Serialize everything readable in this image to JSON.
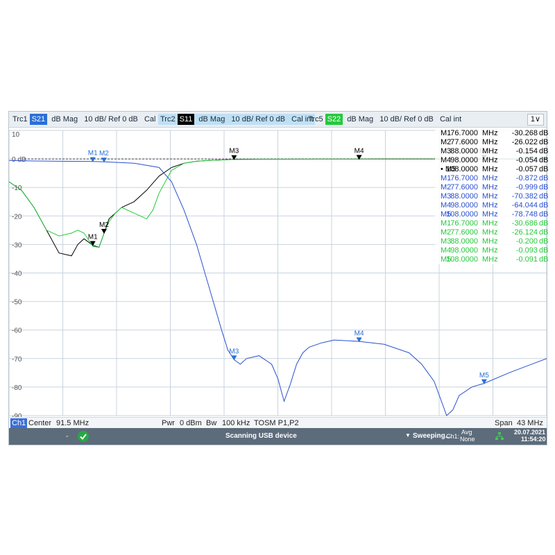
{
  "trace_tabs": [
    {
      "name": "Trc1",
      "param": "S21",
      "param_color": "#2a6fd6",
      "format": "dB Mag",
      "scale": "10 dB/ Ref 0 dB",
      "cal": "Cal int",
      "active": false
    },
    {
      "name": "Trc2",
      "param": "S11",
      "param_color": "#000000",
      "format": "dB Mag",
      "scale": "10 dB/ Ref 0 dB",
      "cal": "Cal int",
      "active": true
    },
    {
      "name": "Trc5",
      "param": "S22",
      "param_color": "#25c93b",
      "format": "dB Mag",
      "scale": "10 dB/ Ref 0 dB",
      "cal": "Cal int",
      "active": false
    }
  ],
  "menu_button": "1∨",
  "chart_data": {
    "type": "line",
    "y_ticks": [
      "10",
      "0 dB",
      "-10",
      "-20",
      "-30",
      "-40",
      "-50",
      "-60",
      "-70",
      "-80",
      "-90"
    ],
    "ylim": [
      -90,
      10
    ],
    "xlim_mhz": [
      70,
      113
    ],
    "ref_value_db": 0,
    "series": [
      {
        "color": "#000000",
        "x": [
          70,
          71,
          72,
          73,
          74,
          75,
          75.5,
          76,
          76.7,
          77.2,
          77.6,
          78,
          78.5,
          79,
          80,
          81,
          82,
          83,
          84,
          85,
          86,
          88,
          90,
          95,
          100,
          105,
          108,
          113
        ],
        "y": [
          -8,
          -11,
          -17,
          -25,
          -33,
          -34,
          -30,
          -28,
          -30.3,
          -31,
          -26,
          -21,
          -19,
          -17,
          -15,
          -11,
          -6,
          -3,
          -1.5,
          -0.8,
          -0.5,
          -0.15,
          -0.1,
          -0.08,
          -0.06,
          -0.06,
          -0.06,
          -0.05
        ]
      },
      {
        "color": "#25c93b",
        "x": [
          70,
          71,
          72,
          73,
          74,
          75,
          75.5,
          76,
          76.7,
          77.2,
          77.6,
          78,
          78.5,
          79,
          80,
          81,
          81.5,
          82,
          83,
          84,
          85,
          86,
          88,
          90,
          95,
          100,
          105,
          108,
          113
        ],
        "y": [
          -8,
          -11,
          -17,
          -25,
          -27,
          -26,
          -25,
          -26,
          -30.7,
          -31,
          -26,
          -22,
          -19,
          -17,
          -19,
          -21,
          -18,
          -12,
          -4,
          -1.5,
          -0.8,
          -0.5,
          -0.2,
          -0.12,
          -0.1,
          -0.09,
          -0.09,
          -0.09,
          -0.08
        ]
      },
      {
        "color": "#2a4fd0",
        "x": [
          70,
          72,
          74,
          76.7,
          77.6,
          80,
          82,
          83,
          84,
          85,
          86,
          87,
          87.5,
          88,
          88.5,
          89,
          90,
          91,
          91.5,
          92,
          92.5,
          93,
          93.5,
          94,
          95,
          96,
          98,
          100,
          102,
          103,
          104,
          104.5,
          105,
          105.5,
          106,
          107,
          108,
          110,
          113
        ],
        "y": [
          -0.5,
          -0.7,
          -0.8,
          -0.87,
          -1.0,
          -1.5,
          -3,
          -8,
          -18,
          -30,
          -45,
          -60,
          -67,
          -70.4,
          -72,
          -70,
          -69,
          -72,
          -77,
          -85,
          -79,
          -72,
          -68,
          -66,
          -64.5,
          -63.5,
          -64.0,
          -65,
          -68,
          -72,
          -78,
          -84,
          -90,
          -88,
          -83,
          -80,
          -78.7,
          -75,
          -70
        ]
      }
    ],
    "markers": [
      {
        "label": "M1",
        "color": "#2a6fd6",
        "x": 76.7,
        "y": -0.872
      },
      {
        "label": "M2",
        "color": "#2a6fd6",
        "x": 77.6,
        "y": -0.999
      },
      {
        "label": "M1",
        "color": "#000000",
        "x": 76.7,
        "y": -30.268
      },
      {
        "label": "M2",
        "color": "#000000",
        "x": 77.6,
        "y": -26.022
      },
      {
        "label": "M3",
        "color": "#000000",
        "x": 88,
        "y": -0.154
      },
      {
        "label": "M4",
        "color": "#000000",
        "x": 98,
        "y": -0.054
      },
      {
        "label": "M5",
        "color": "#000000",
        "x": 108,
        "y": -0.057
      },
      {
        "label": "M3",
        "color": "#2a6fd6",
        "x": 88,
        "y": -70.382
      },
      {
        "label": "M4",
        "color": "#2a6fd6",
        "x": 98,
        "y": -64.044
      },
      {
        "label": "M5",
        "color": "#2a6fd6",
        "x": 108,
        "y": -78.748
      }
    ]
  },
  "marker_table": [
    {
      "color": "#000000",
      "rows": [
        {
          "m": "M1",
          "f": "76.7000",
          "u": "MHz",
          "v": "-30.268",
          "d": "dB"
        },
        {
          "m": "M2",
          "f": "77.6000",
          "u": "MHz",
          "v": "-26.022",
          "d": "dB"
        },
        {
          "m": "M3",
          "f": "88.0000",
          "u": "MHz",
          "v": "-0.154",
          "d": "dB"
        },
        {
          "m": "M4",
          "f": "98.0000",
          "u": "MHz",
          "v": "-0.054",
          "d": "dB"
        },
        {
          "m": "• M5",
          "f": "108.0000",
          "u": "MHz",
          "v": "-0.057",
          "d": "dB"
        }
      ]
    },
    {
      "color": "#2a4fd0",
      "rows": [
        {
          "m": "M1",
          "f": "76.7000",
          "u": "MHz",
          "v": "-0.872",
          "d": "dB"
        },
        {
          "m": "M2",
          "f": "77.6000",
          "u": "MHz",
          "v": "-0.999",
          "d": "dB"
        },
        {
          "m": "M3",
          "f": "88.0000",
          "u": "MHz",
          "v": "-70.382",
          "d": "dB"
        },
        {
          "m": "M4",
          "f": "98.0000",
          "u": "MHz",
          "v": "-64.044",
          "d": "dB"
        },
        {
          "m": "M5",
          "f": "108.0000",
          "u": "MHz",
          "v": "-78.748",
          "d": "dB"
        }
      ]
    },
    {
      "color": "#25c93b",
      "rows": [
        {
          "m": "M1",
          "f": "76.7000",
          "u": "MHz",
          "v": "-30.686",
          "d": "dB"
        },
        {
          "m": "M2",
          "f": "77.6000",
          "u": "MHz",
          "v": "-26.124",
          "d": "dB"
        },
        {
          "m": "M3",
          "f": "88.0000",
          "u": "MHz",
          "v": "-0.200",
          "d": "dB"
        },
        {
          "m": "M4",
          "f": "98.0000",
          "u": "MHz",
          "v": "-0.093",
          "d": "dB"
        },
        {
          "m": "M5",
          "f": "108.0000",
          "u": "MHz",
          "v": "-0.091",
          "d": "dB"
        }
      ]
    }
  ],
  "status_bar": {
    "channel": "Ch1",
    "center_label": "Center",
    "center_value": "91.5 MHz",
    "pwr_label": "Pwr",
    "pwr_value": "0 dBm",
    "bw_label": "Bw",
    "bw_value": "100 kHz",
    "cal_state": "TOSM P1,P2",
    "span_label": "Span",
    "span_value": "43 MHz"
  },
  "taskbar": {
    "status_icon": "check-circle-icon",
    "message": "Scanning USB device",
    "sweep_label": "Sweeping...",
    "ch_label": "Ch1:",
    "avg_label": "Avg",
    "avg_value": "None",
    "date": "20.07.2021",
    "time": "11:54:20"
  }
}
